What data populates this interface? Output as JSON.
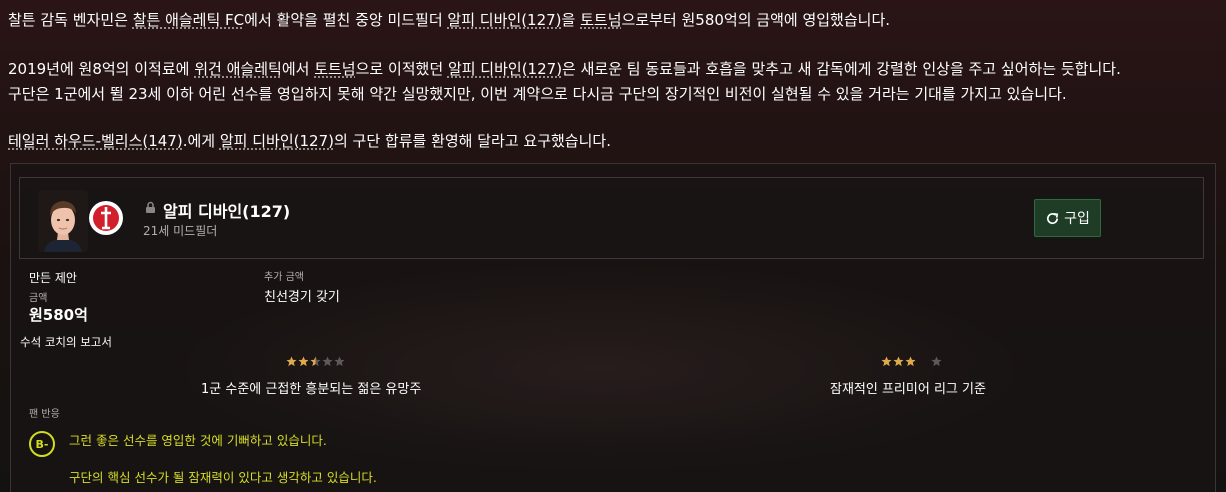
{
  "news": {
    "p1": {
      "seg1": "찰튼 감독 벤자민은 ",
      "club": "찰튼 애슬레틱 FC",
      "seg2": "에서 활약을 펼친 중앙 미드필더 ",
      "player": "알피 디바인(127)",
      "seg3": "을 ",
      "club2": "토트넘",
      "seg4": "으로부터 원580억의 금액에 영입했습니다."
    },
    "p2a": {
      "seg1": "2019년에 원8억의 이적료에 ",
      "club": "위건 애슬레틱",
      "seg2": "에서 ",
      "club2": "토트넘",
      "seg3": "으로 이적했던 ",
      "player": "알피 디바인(127)",
      "seg4": "은 새로운 팀 동료들과 호흡을 맞추고 새 감독에게 강렬한 인상을 주고 싶어하는 듯합니다."
    },
    "p2b": "구단은 1군에서 뛸 23세 이하 어린 선수를 영입하지 못해 약간 실망했지만, 이번 계약으로 다시금 구단의 장기적인 비전이 실현될 수 있을 거라는 기대를 가지고 있습니다.",
    "p3": {
      "player1": "테일러 하우드-벨리스(147)",
      "seg1": ".에게 ",
      "player2": "알피 디바인(127)",
      "seg2": "의 구단 합류를 환영해 달라고 요구했습니다."
    }
  },
  "player": {
    "name": "알피 디바인(127)",
    "subtitle": "21세 미드필더",
    "crest_text": "CHARLTON ATHLETIC",
    "buy_label": "구입"
  },
  "offer": {
    "title": "만든 제안",
    "fee_label": "금액",
    "fee_value": "원580억",
    "extra_label": "추가 금액",
    "extra_value": "친선경기 갖기"
  },
  "scout": {
    "title": "수석 코치의 보고서",
    "current": {
      "stars": 2.5,
      "max": 5,
      "label": "1군 수준에 근접한 흥분되는 젊은 유망주"
    },
    "potential": {
      "stars": 3,
      "max": 4,
      "label": "잠재적인 프리미어 리그 기준"
    }
  },
  "fans": {
    "title": "팬 반응",
    "grade": "B-",
    "line1": "그런 좋은 선수를 영입한 것에 기뻐하고 있습니다.",
    "line2": "구단의 핵심 선수가 될 잠재력이 있다고 생각하고 있습니다."
  },
  "colors": {
    "accent_yellow": "#d2dd1e",
    "buy_green": "#1f3d26",
    "star_gold": "#e0a94a",
    "star_empty": "#5f5a5a"
  }
}
